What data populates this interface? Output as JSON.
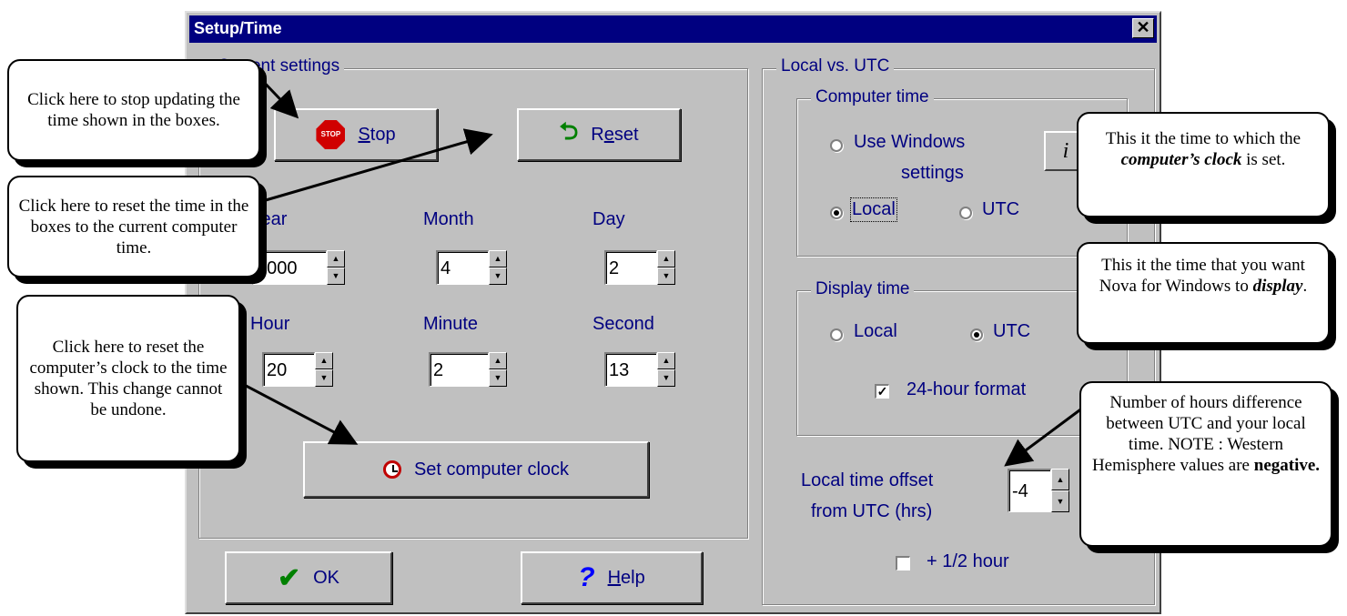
{
  "dialog": {
    "title": "Setup/Time",
    "close_glyph": "✕"
  },
  "current_settings": {
    "label": "Current settings",
    "stop_label": "Stop",
    "stop_accel": "S",
    "stop_rest": "top",
    "stop_icon": "STOP",
    "reset_label": "Reset",
    "reset_pre": "R",
    "reset_accel": "e",
    "reset_rest": "set",
    "fields": [
      {
        "label": "Year",
        "value": "2000"
      },
      {
        "label": "Month",
        "value": "4"
      },
      {
        "label": "Day",
        "value": "2"
      },
      {
        "label": "Hour",
        "value": "20"
      },
      {
        "label": "Minute",
        "value": "2"
      },
      {
        "label": "Second",
        "value": "13"
      }
    ],
    "set_clock_label": "Set computer clock"
  },
  "footer": {
    "ok_label": "OK",
    "help_accel": "H",
    "help_rest": "elp"
  },
  "local_vs_utc": {
    "label": "Local vs. UTC",
    "computer_time": {
      "label": "Computer time",
      "use_windows_line1": "Use Windows",
      "use_windows_line2": "settings",
      "local_label": "Local",
      "utc_label": "UTC",
      "selected": "Local"
    },
    "display_time": {
      "label": "Display time",
      "local_label": "Local",
      "utc_label": "UTC",
      "selected": "UTC",
      "format_24h_label": "24-hour format",
      "format_24h_checked": true
    },
    "offset_label_line1": "Local time offset",
    "offset_label_line2": "from UTC (hrs)",
    "offset_value": "-4",
    "half_hour_label": "+ 1/2 hour",
    "half_hour_checked": false
  },
  "callouts": {
    "stop": "Click here to stop updating the time shown in the boxes.",
    "reset": "Click here to reset the time in the boxes to the current computer time.",
    "set_clock": "Click here to reset the computer’s clock to the time shown.  This change cannot be undone.",
    "computer_time_pre": "This it the time to which the ",
    "computer_time_em": "computer’s clock",
    "computer_time_post": " is set.",
    "display_time_pre": "This it the time that you want Nova for Windows to ",
    "display_time_em": "display",
    "display_time_post": ".",
    "offset_pre": "Number of hours difference between UTC and your local time. NOTE : Western Hemisphere values are ",
    "offset_bold": "negative."
  },
  "colors": {
    "titlebar": "#000080",
    "dialog_bg": "#c0c0c0",
    "label_text": "#000080"
  }
}
